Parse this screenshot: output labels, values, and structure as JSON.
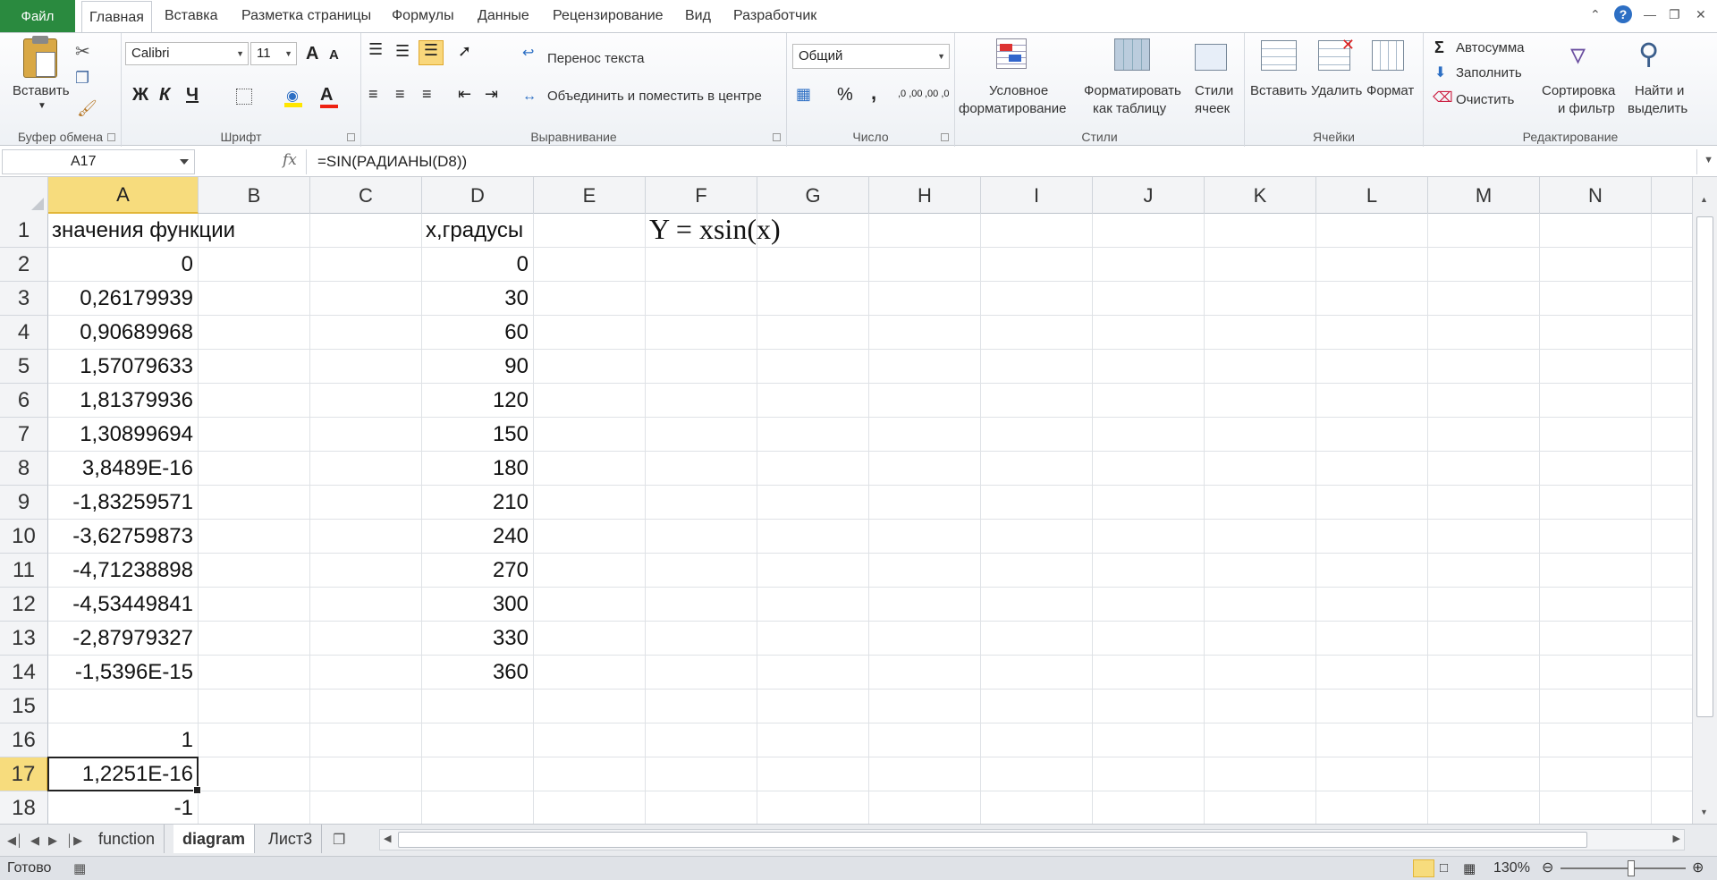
{
  "tabs": {
    "file": "Файл",
    "items": [
      "Главная",
      "Вставка",
      "Разметка страницы",
      "Формулы",
      "Данные",
      "Рецензирование",
      "Вид",
      "Разработчик"
    ],
    "active": "Главная"
  },
  "ribbon": {
    "clipboard": {
      "paste": "Вставить",
      "group": "Буфер обмена"
    },
    "font": {
      "name": "Calibri",
      "size": "11",
      "bold": "Ж",
      "italic": "К",
      "underline": "Ч",
      "grow": "A",
      "shrink": "A",
      "color_letter": "A",
      "group": "Шрифт"
    },
    "alignment": {
      "wrap": "Перенос текста",
      "merge": "Объединить и поместить в центре",
      "group": "Выравнивание"
    },
    "number": {
      "format": "Общий",
      "percent": "%",
      "comma": ",",
      "inc": ",0 ,00",
      "dec": ",00 ,0",
      "group": "Число"
    },
    "styles": {
      "conditional_1": "Условное",
      "conditional_2": "форматирование",
      "table_1": "Форматировать",
      "table_2": "как таблицу",
      "cell_1": "Стили",
      "cell_2": "ячеек",
      "group": "Стили"
    },
    "cells": {
      "insert": "Вставить",
      "delete": "Удалить",
      "format": "Формат",
      "group": "Ячейки"
    },
    "editing": {
      "autosum": "Автосумма",
      "fill": "Заполнить",
      "clear": "Очистить",
      "sort_1": "Сортировка",
      "sort_2": "и фильтр",
      "find_1": "Найти и",
      "find_2": "выделить",
      "group": "Редактирование"
    }
  },
  "formula_bar": {
    "name_box": "A17",
    "fx": "fx",
    "formula": "=SIN(РАДИАНЫ(D8))"
  },
  "columns": [
    "A",
    "B",
    "C",
    "D",
    "E",
    "F",
    "G",
    "H",
    "I",
    "J",
    "K",
    "L",
    "M",
    "N"
  ],
  "selected_column": "A",
  "rows": [
    "1",
    "2",
    "3",
    "4",
    "5",
    "6",
    "7",
    "8",
    "9",
    "10",
    "11",
    "12",
    "13",
    "14",
    "15",
    "16",
    "17",
    "18"
  ],
  "selected_row": "17",
  "cells": {
    "A1": "значения функции",
    "D1": "x,градусы",
    "F1": "Y = xsin(x)",
    "A": [
      "0",
      "0,26179939",
      "0,90689968",
      "1,57079633",
      "1,81379936",
      "1,30899694",
      "3,8489E-16",
      "-1,83259571",
      "-3,62759873",
      "-4,71238898",
      "-4,53449841",
      "-2,87979327",
      "-1,5396E-15"
    ],
    "D": [
      "0",
      "30",
      "60",
      "90",
      "120",
      "150",
      "180",
      "210",
      "240",
      "270",
      "300",
      "330",
      "360"
    ],
    "A16": "1",
    "A17": "1,2251E-16",
    "A18": "-1"
  },
  "sheets": [
    "function",
    "diagram",
    "Лист3"
  ],
  "active_sheet": "diagram",
  "status": {
    "ready": "Готово",
    "zoom": "130%"
  },
  "colors": {
    "file_tab": "#2a8a3f",
    "selection_header": "#f7dc7d"
  }
}
